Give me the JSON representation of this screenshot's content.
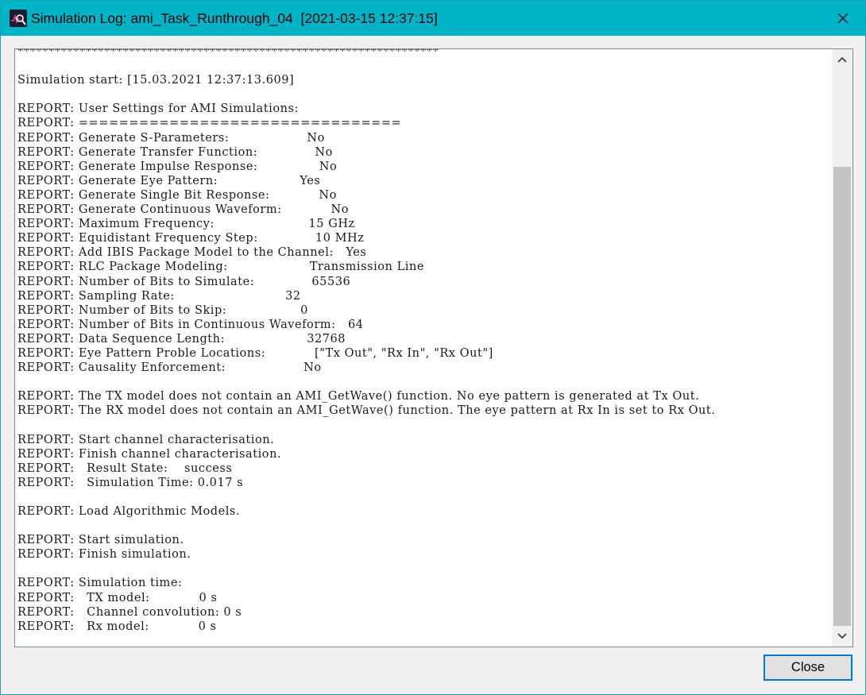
{
  "window": {
    "title": "Simulation Log: ami_Task_Runthrough_04  [2021-03-15 12:37:15]",
    "app_icon": "waveform-search-icon",
    "close_icon": "close-icon"
  },
  "log": {
    "lines": [
      "********************************************************************",
      "",
      "Simulation start: [15.03.2021 12:37:13.609]",
      "",
      "REPORT: User Settings for AMI Simulations:",
      "REPORT: ================================",
      "REPORT: Generate S-Parameters:                   No",
      "REPORT: Generate Transfer Function:              No",
      "REPORT: Generate Impulse Response:               No",
      "REPORT: Generate Eye Pattern:                    Yes",
      "REPORT: Generate Single Bit Response:            No",
      "REPORT: Generate Continuous Waveform:            No",
      "REPORT: Maximum Frequency:                       15 GHz",
      "REPORT: Equidistant Frequency Step:              10 MHz",
      "REPORT: Add IBIS Package Model to the Channel:   Yes",
      "REPORT: RLC Package Modeling:                    Transmission Line",
      "REPORT: Number of Bits to Simulate:              65536",
      "REPORT: Sampling Rate:                           32",
      "REPORT: Number of Bits to Skip:                  0",
      "REPORT: Number of Bits in Continuous Waveform:   64",
      "REPORT: Data Sequence Length:                    32768",
      "REPORT: Eye Pattern Proble Locations:            [\"Tx Out\", \"Rx In\", \"Rx Out\"]",
      "REPORT: Causality Enforcement:                   No",
      "",
      "REPORT: The TX model does not contain an AMI_GetWave() function. No eye pattern is generated at Tx Out.",
      "REPORT: The RX model does not contain an AMI_GetWave() function. The eye pattern at Rx In is set to Rx Out.",
      "",
      "REPORT: Start channel characterisation.",
      "REPORT: Finish channel characterisation.",
      "REPORT:   Result State:    success",
      "REPORT:   Simulation Time: 0.017 s",
      "",
      "REPORT: Load Algorithmic Models.",
      "",
      "REPORT: Start simulation.",
      "REPORT: Finish simulation.",
      "",
      "REPORT: Simulation time:",
      "REPORT:   TX model:            0 s",
      "REPORT:   Channel convolution: 0 s",
      "REPORT:   Rx model:            0 s"
    ]
  },
  "scrollbar": {
    "up_icon": "chevron-up-icon",
    "down_icon": "chevron-down-icon",
    "position": 0.2
  },
  "footer": {
    "close_label": "Close"
  },
  "colors": {
    "titlebar": "#00b4c8",
    "button_border": "#0078d7"
  }
}
